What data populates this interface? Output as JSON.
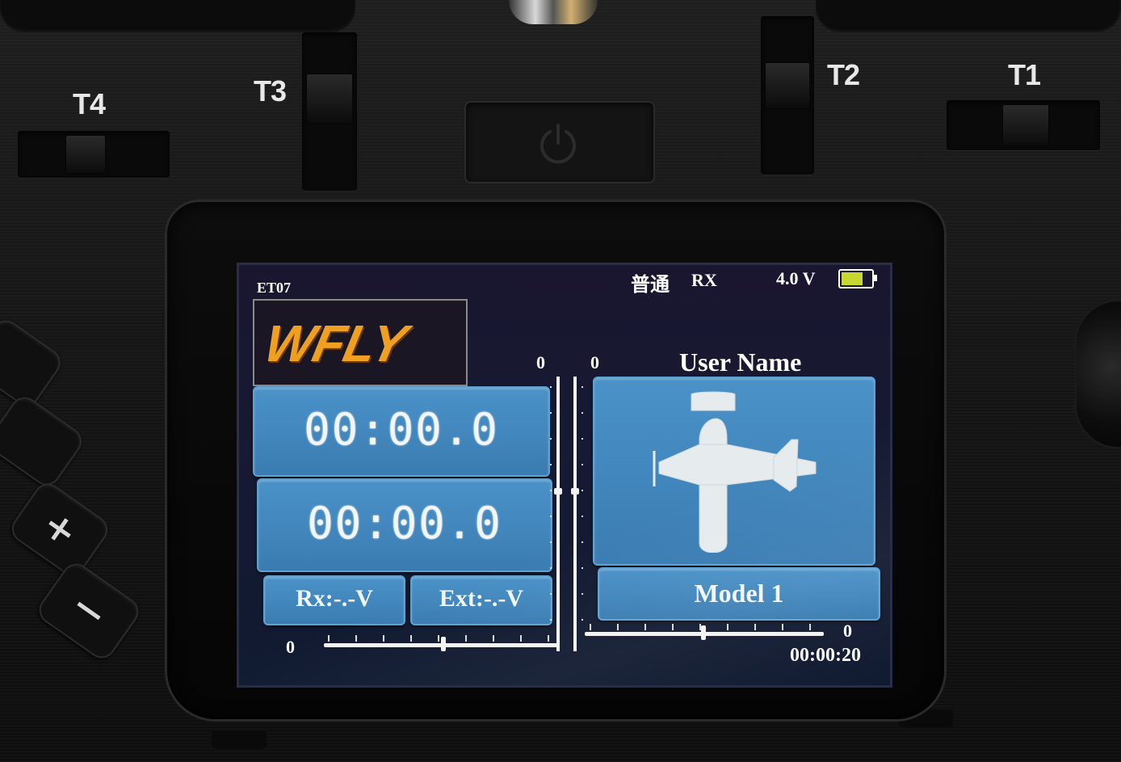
{
  "transmitter": {
    "trim_labels": {
      "t4": "T4",
      "t3": "T3",
      "t2": "T2",
      "t1": "T1"
    },
    "power_icon": "power-icon"
  },
  "screen": {
    "status_bar": {
      "model_id": "ET07",
      "mode": "普通",
      "rx": "RX",
      "voltage": "4.0 V",
      "battery_icon": "battery-icon",
      "battery_level": 0.75
    },
    "logo": "WFLY",
    "timers": [
      "00:00.0",
      "00:00.0"
    ],
    "rx_voltage": "Rx:-.-V",
    "ext_voltage": "Ext:-.-V",
    "user_name": "User Name",
    "model_image": "airplane-icon",
    "model_name": "Model 1",
    "vertical_trims": {
      "left_value": "0",
      "right_value": "0"
    },
    "horizontal_trims": {
      "left_value": "0",
      "right_value": "0"
    },
    "clock": "00:00:20",
    "accent_colors": {
      "panel": "#4a92c8",
      "logo": "#f0a020",
      "battery": "#c8d830"
    }
  }
}
